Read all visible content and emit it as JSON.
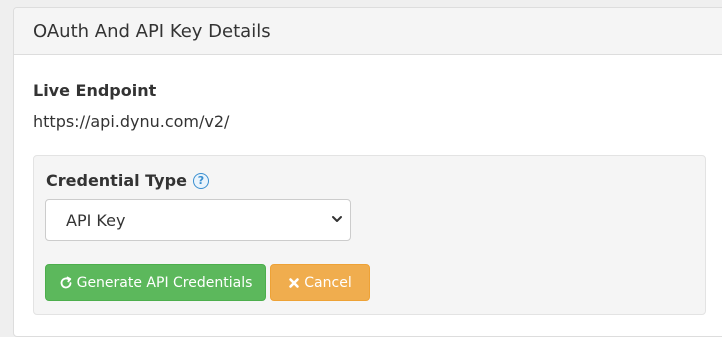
{
  "panel": {
    "title": "OAuth And API Key Details"
  },
  "endpoint": {
    "label": "Live Endpoint",
    "value": "https://api.dynu.com/v2/"
  },
  "credential": {
    "label": "Credential Type",
    "help_icon": "question-circle",
    "selected_option": "API Key"
  },
  "buttons": {
    "generate_label": "Generate API Credentials",
    "generate_icon": "refresh",
    "cancel_label": "Cancel",
    "cancel_icon": "times"
  },
  "colors": {
    "generate_button": "#5cb85c",
    "cancel_button": "#f0ad4e",
    "help_icon": "#3a8fd0"
  }
}
